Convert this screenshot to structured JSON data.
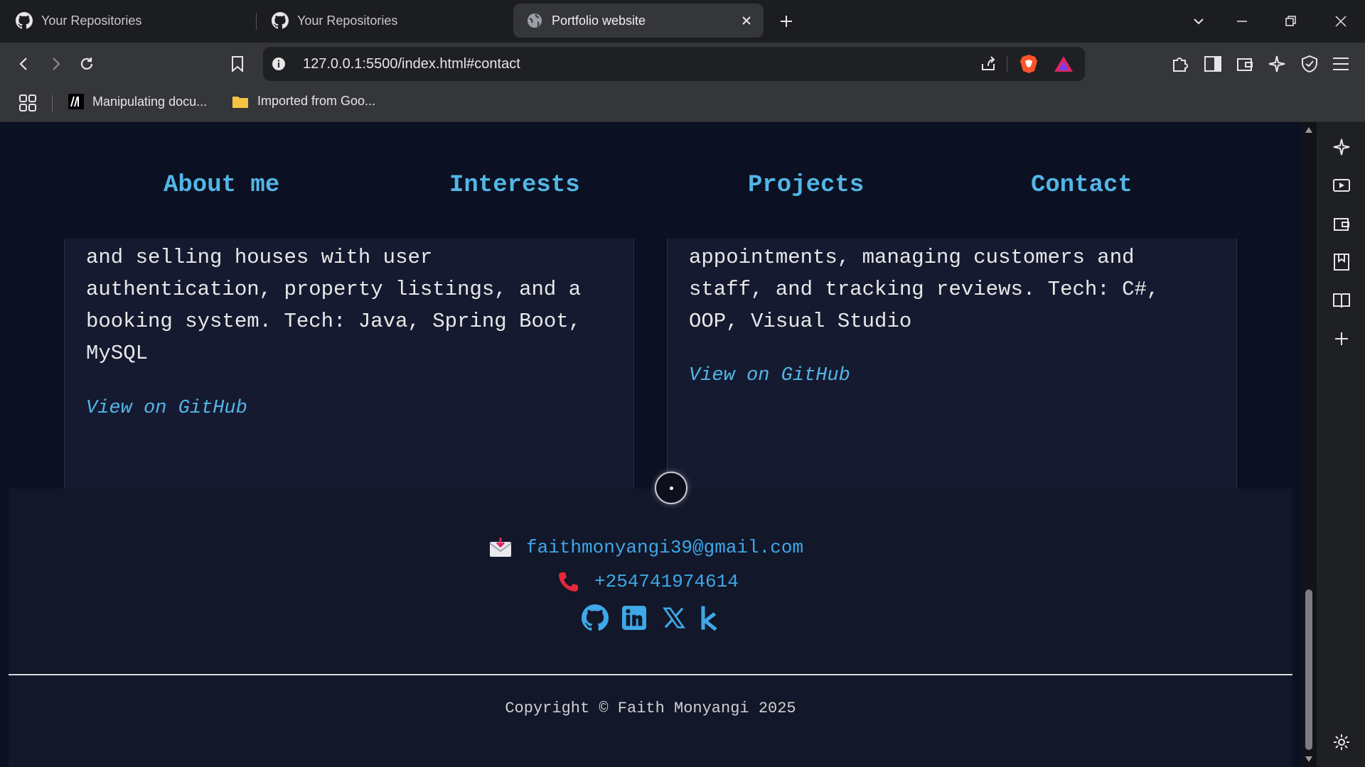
{
  "browser": {
    "tabs": [
      {
        "title": "Your Repositories"
      },
      {
        "title": "Your Repositories"
      },
      {
        "title": "Portfolio website"
      }
    ],
    "url": "127.0.0.1:5500/index.html#contact",
    "bookmarks": [
      {
        "label": "Manipulating docu..."
      },
      {
        "label": "Imported from Goo..."
      }
    ]
  },
  "nav": {
    "links": [
      "About me",
      "Interests",
      "Projects",
      "Contact"
    ]
  },
  "projects": [
    {
      "lines": [
        "and selling houses with user",
        "authentication, property listings, and a",
        "booking system. Tech: Java, Spring Boot,",
        "MySQL"
      ],
      "link": "View on GitHub"
    },
    {
      "lines": [
        "appointments, managing customers and",
        "staff, and tracking reviews. Tech: C#,",
        "OOP, Visual Studio"
      ],
      "link": "View on GitHub"
    }
  ],
  "contact": {
    "email": "faithmonyangi39@gmail.com",
    "phone": "+254741974614",
    "social_icons": [
      "github-icon",
      "linkedin-icon",
      "x-icon",
      "kaggle-icon"
    ]
  },
  "footer": {
    "copyright": "Copyright © Faith Monyangi 2025"
  },
  "colors": {
    "accent": "#52b6e6",
    "page_bg": "#0b1022",
    "card_bg": "#151a30"
  }
}
